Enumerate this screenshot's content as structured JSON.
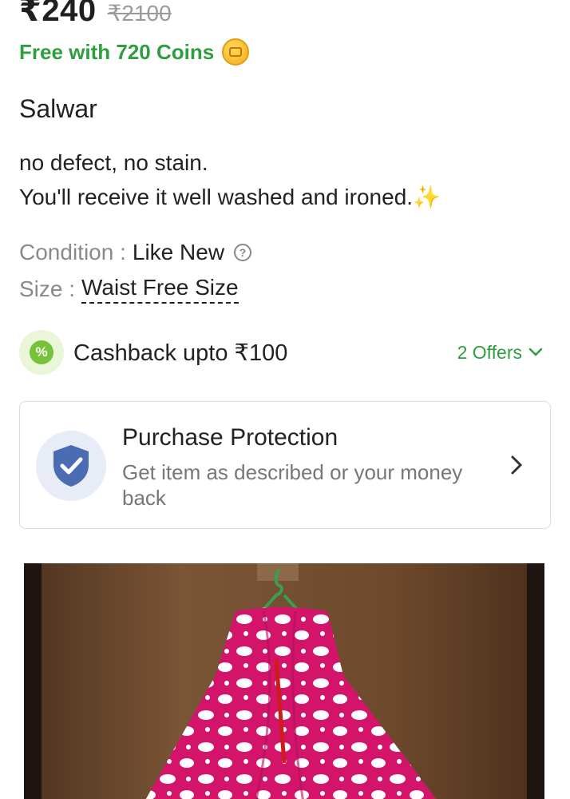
{
  "price": {
    "current": "₹240",
    "original": "₹2100"
  },
  "coins": {
    "text": "Free with 720 Coins",
    "icon": "coin-icon"
  },
  "product": {
    "title": "Salwar",
    "description_line1": "no defect, no stain.",
    "description_line2": "You'll receive it well washed and ironed.",
    "description_emoji": "✨"
  },
  "attributes": {
    "condition_label": "Condition :",
    "condition_value": "Like New",
    "size_label": "Size :",
    "size_value": "Waist Free Size"
  },
  "cashback": {
    "text": "Cashback upto ₹100",
    "offers_label": "2 Offers",
    "icon": "percent-badge-icon"
  },
  "protection": {
    "title": "Purchase Protection",
    "subtitle": "Get item as described or your money back",
    "icon": "shield-check-icon"
  },
  "colors": {
    "accent_green": "#2f9e3e",
    "shield_blue": "#4a6cb3",
    "product_pink": "#d4146b"
  }
}
